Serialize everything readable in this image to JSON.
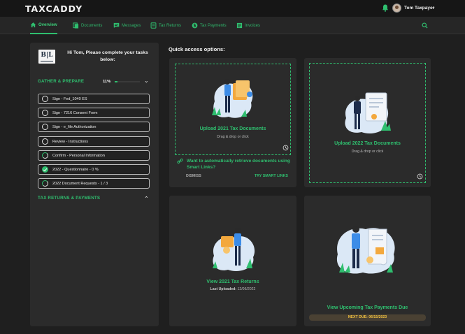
{
  "app": {
    "logo_a": "TA",
    "logo_x": "X",
    "logo_b": "CADDY"
  },
  "user": {
    "name": "Tom Taxpayer",
    "chevron": "⌄"
  },
  "nav": {
    "items": [
      {
        "label": "Overview",
        "icon": "home-icon"
      },
      {
        "label": "Documents",
        "icon": "documents-icon"
      },
      {
        "label": "Messages",
        "icon": "messages-icon"
      },
      {
        "label": "Tax Returns",
        "icon": "tax-returns-icon"
      },
      {
        "label": "Tax Payments",
        "icon": "tax-payments-icon"
      },
      {
        "label": "Invoices",
        "icon": "invoices-icon"
      }
    ],
    "active": "Overview"
  },
  "left": {
    "firm_logo": "B|L",
    "greeting": "Hi Tom, Please complete your tasks below:",
    "gather": {
      "title": "GATHER & PREPARE",
      "percent_label": "11%",
      "progress": 0.11
    },
    "tasks": [
      {
        "label": "Sign - Fed_1040 ES",
        "status": "open"
      },
      {
        "label": "Sign - 7216 Consent Form",
        "status": "open"
      },
      {
        "label": "Sign - e_file Authorization",
        "status": "open"
      },
      {
        "label": "Review - Instructions",
        "status": "open"
      },
      {
        "label": "Confirm - Personal Information",
        "status": "partial"
      },
      {
        "label": "2022 - Questionnaire - 0 %",
        "status": "done"
      },
      {
        "label": "2022 Document Requests - 1 / 3",
        "status": "partial"
      }
    ],
    "tax_returns": {
      "title": "TAX RETURNS & PAYMENTS"
    }
  },
  "quick_access": {
    "title": "Quick access options:",
    "upload_2021": {
      "title": "Upload 2021 Tax Documents",
      "sub": "Drag & drop or click"
    },
    "upload_2022": {
      "title": "Upload 2022 Tax Documents",
      "sub": "Drag & drop or click"
    },
    "smart_links": {
      "text": "Want to automatically retrieve documents using Smart Links?",
      "dismiss": "DISMISS",
      "try": "TRY SMART LINKS"
    },
    "view_2021": {
      "title": "View 2021 Tax Returns",
      "sub_label": "Last Uploaded:",
      "sub_value": "12/06/2022"
    },
    "payments": {
      "title": "View Upcoming Tax Payments Due",
      "due": "NEXT DUE: 06/15/2023"
    }
  },
  "colors": {
    "accent": "#2fbf6f",
    "bg": "#1f1f1f",
    "panel": "#2b2b2b",
    "warning": "#f0c040"
  }
}
